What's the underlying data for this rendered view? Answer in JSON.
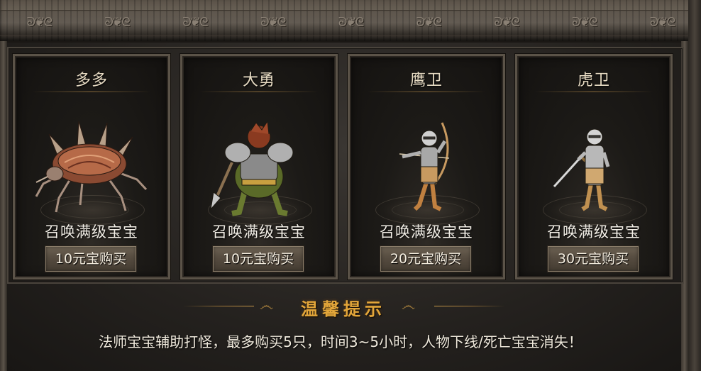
{
  "header": {
    "ornament": "ↄↄ"
  },
  "pets": [
    {
      "name": "多多",
      "summon_label": "召唤满级宝宝",
      "buy_label": "10元宝购买",
      "icon": "spiked-beetle-icon"
    },
    {
      "name": "大勇",
      "summon_label": "召唤满级宝宝",
      "buy_label": "10元宝购买",
      "icon": "armored-orc-icon"
    },
    {
      "name": "鹰卫",
      "summon_label": "召唤满级宝宝",
      "buy_label": "20元宝购买",
      "icon": "archer-guard-icon"
    },
    {
      "name": "虎卫",
      "summon_label": "召唤满级宝宝",
      "buy_label": "30元宝购买",
      "icon": "swordsman-guard-icon"
    }
  ],
  "tips": {
    "title": "温馨提示",
    "text": "法师宝宝辅助打怪，最多购买5只，时间3~5小时，人物下线/死亡宝宝消失！"
  },
  "colors": {
    "tips_title": "#e3a63a",
    "ornament_gold": "#b5893f",
    "button_face": "#564c40"
  }
}
